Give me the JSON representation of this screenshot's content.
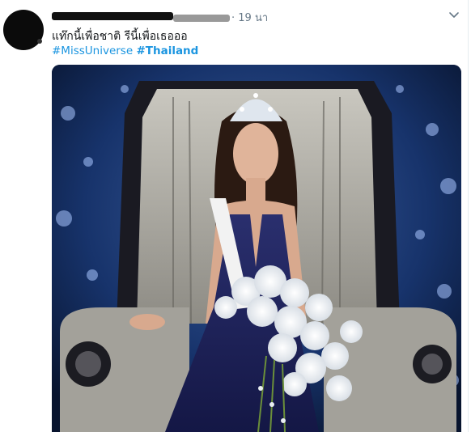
{
  "tweet": {
    "timestamp": "· 19 นา",
    "text": "แท๊กนี้เพื่อชาติ รีนี้เพื่อเธอออ",
    "hashtags": [
      "#MissUniverse",
      "#Thailand"
    ],
    "media_alt": "Photo of Miss Universe Thailand seated on a throne wearing a crown and holding white orchids"
  },
  "colors": {
    "link": "#1b95e0",
    "muted": "#657786",
    "text": "#14171a"
  },
  "icons": {
    "menu": "chevron-down-icon"
  }
}
